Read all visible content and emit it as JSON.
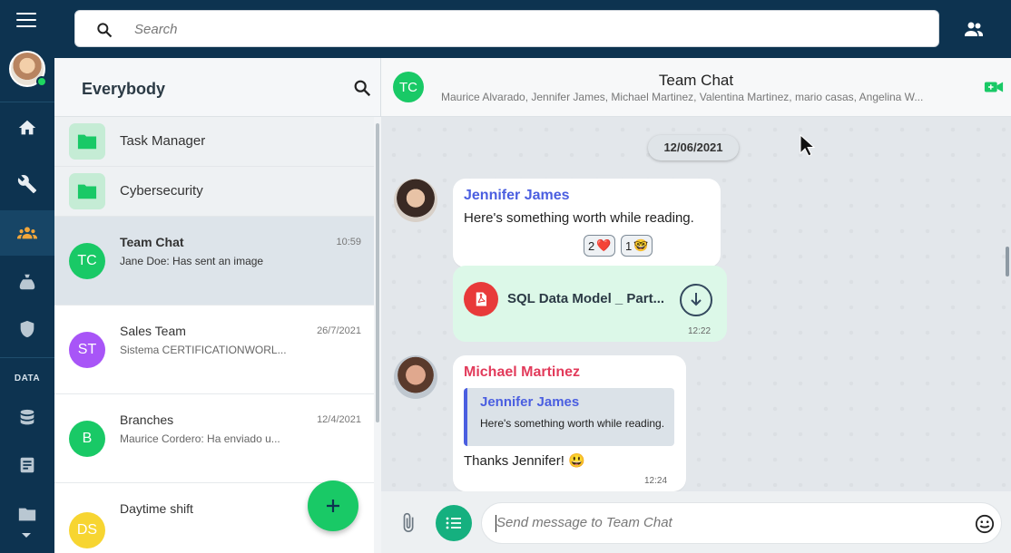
{
  "rail": {
    "icons": [
      "menu-icon",
      "home-icon",
      "wrench-icon",
      "team-icon",
      "bag-icon",
      "shield-icon",
      "database-icon",
      "document-icon",
      "folder-icon"
    ],
    "section_label": "DATA"
  },
  "search": {
    "placeholder": "Search"
  },
  "list": {
    "title": "Everybody",
    "groups": [
      {
        "name": "Task Manager"
      },
      {
        "name": "Cybersecurity"
      }
    ],
    "conversations": [
      {
        "initials": "TC",
        "name": "Team Chat",
        "time": "10:59",
        "preview": "Jane Doe: Has sent an image",
        "color": "#19c966",
        "selected": true
      },
      {
        "initials": "ST",
        "name": "Sales Team",
        "time": "26/7/2021",
        "preview": "Sistema CERTIFICATIONWORL...",
        "color": "#a855f7"
      },
      {
        "initials": "B",
        "name": "Branches",
        "time": "12/4/2021",
        "preview": "Maurice Cordero: Ha enviado u...",
        "color": "#19c966"
      },
      {
        "initials": "DS",
        "name": "Daytime shift",
        "time": "",
        "preview": "",
        "color": "#f7d531"
      }
    ]
  },
  "chat": {
    "avatar": "TC",
    "title": "Team Chat",
    "members": "Maurice Alvarado, Jennifer James, Michael Martinez, Valentina Martinez, mario casas, Angelina W...",
    "date": "12/06/2021",
    "messages": {
      "m1": {
        "sender": "Jennifer James",
        "text": "Here's something worth while reading.",
        "reactions": [
          {
            "count": "2",
            "emoji": "❤️"
          },
          {
            "count": "1",
            "emoji": "🤓"
          }
        ]
      },
      "file": {
        "name": "SQL Data Model _ Part...",
        "time": "12:22"
      },
      "m2": {
        "sender": "Michael Martinez",
        "quote_sender": "Jennifer James",
        "quote_text": "Here's something worth while reading.",
        "text": "Thanks Jennifer! 😃",
        "time": "12:24"
      }
    },
    "composer": {
      "placeholder": "Send message to Team Chat"
    }
  },
  "colors": {
    "rail": "#0d3350",
    "accent": "#19c966",
    "jennifer": "#4a5ee0",
    "michael": "#e23b5b",
    "pdf": "#e83a3a"
  }
}
